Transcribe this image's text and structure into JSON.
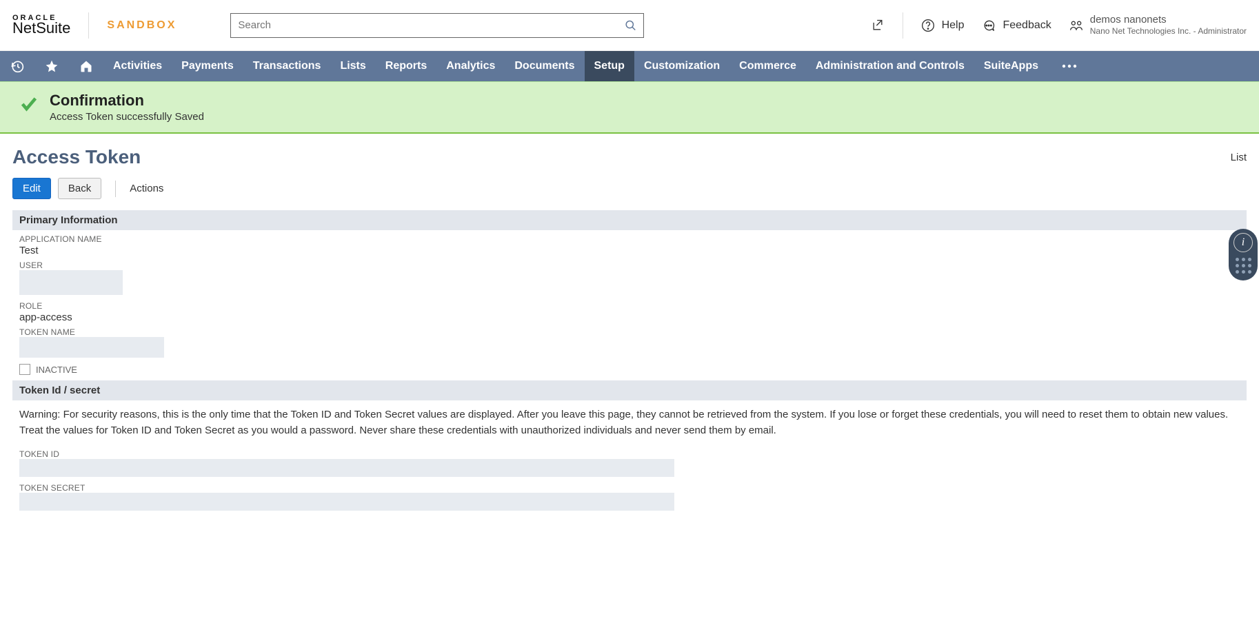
{
  "header": {
    "oracle_small": "ORACLE",
    "oracle_big": "NetSuite",
    "env_label": "SANDBOX",
    "search_placeholder": "Search",
    "help_label": "Help",
    "feedback_label": "Feedback",
    "user": {
      "name": "demos nanonets",
      "company": "Nano Net Technologies Inc.",
      "role_sep": " - ",
      "role": "Administrator"
    }
  },
  "nav": {
    "items": [
      "Activities",
      "Payments",
      "Transactions",
      "Lists",
      "Reports",
      "Analytics",
      "Documents",
      "Setup",
      "Customization",
      "Commerce",
      "Administration and Controls",
      "SuiteApps"
    ],
    "active_index": 7
  },
  "confirmation": {
    "title": "Confirmation",
    "message": "Access Token successfully Saved"
  },
  "page": {
    "title": "Access Token",
    "list_link": "List",
    "buttons": {
      "edit": "Edit",
      "back": "Back",
      "actions": "Actions"
    },
    "sections": {
      "primary": {
        "header": "Primary Information",
        "fields": {
          "application_name": {
            "label": "APPLICATION NAME",
            "value": "Test"
          },
          "user": {
            "label": "USER",
            "value": ""
          },
          "role": {
            "label": "ROLE",
            "value": "app-access"
          },
          "token_name": {
            "label": "TOKEN NAME",
            "value": ""
          },
          "inactive": {
            "label": "INACTIVE",
            "checked": false
          }
        }
      },
      "token": {
        "header": "Token Id / secret",
        "warning_line1": "Warning: For security reasons, this is the only time that the Token ID and Token Secret values are displayed. After you leave this page, they cannot be retrieved from the system. If you lose or forget these credentials, you will need to reset them to obtain new values.",
        "warning_line2": "Treat the values for Token ID and Token Secret as you would a password. Never share these credentials with unauthorized individuals and never send them by email.",
        "token_id": {
          "label": "TOKEN ID",
          "value": ""
        },
        "token_secret": {
          "label": "TOKEN SECRET",
          "value": ""
        }
      }
    }
  }
}
